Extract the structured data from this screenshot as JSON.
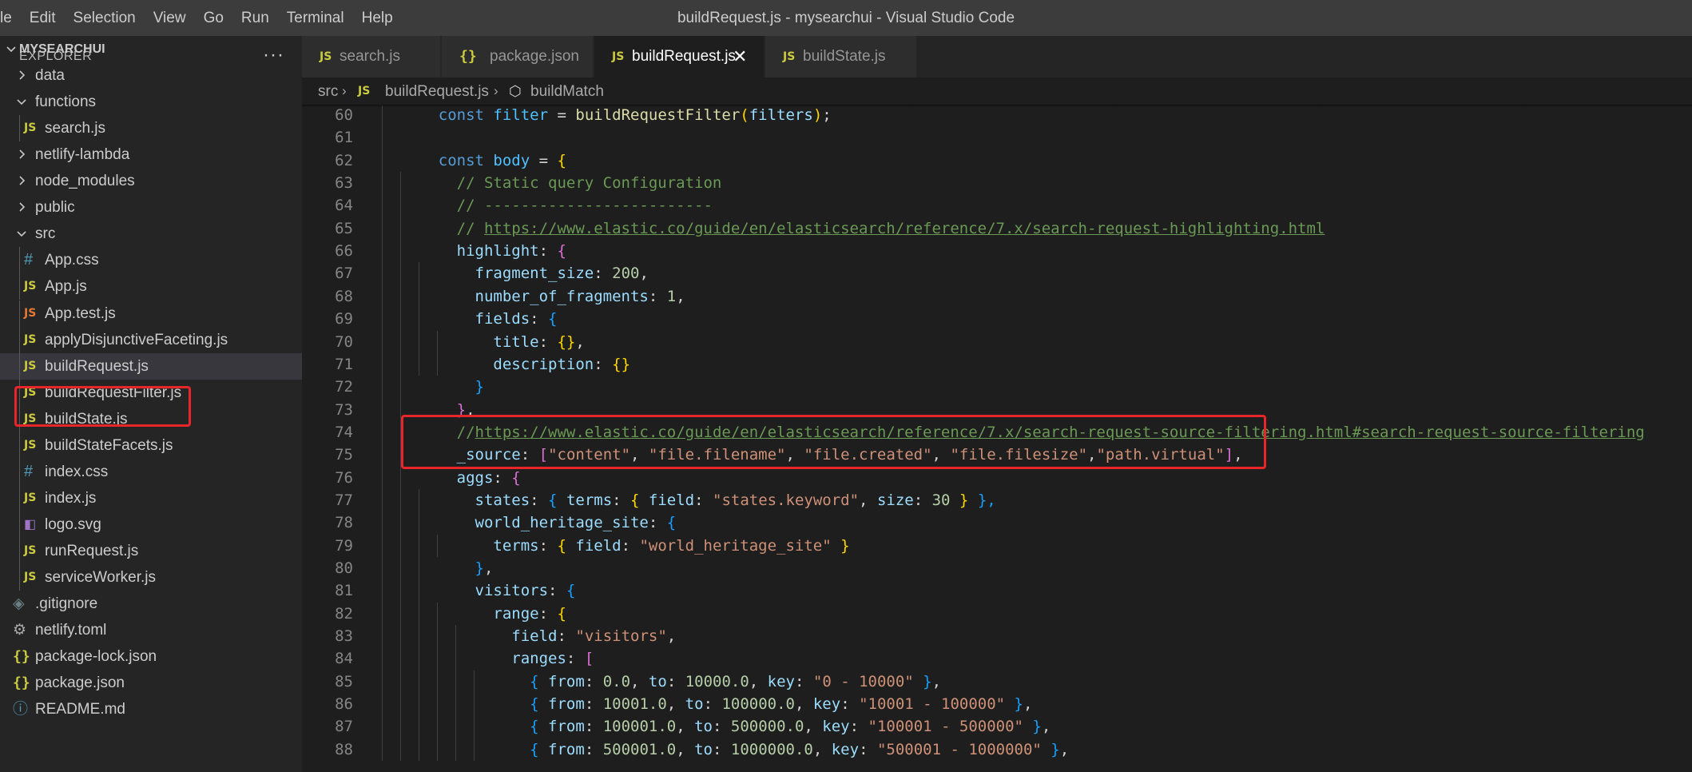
{
  "menu": {
    "items": [
      "le",
      "Edit",
      "Selection",
      "View",
      "Go",
      "Run",
      "Terminal",
      "Help"
    ]
  },
  "window_title": "buildRequest.js - mysearchui - Visual Studio Code",
  "sidebar": {
    "title": "EXPLORER",
    "more_icon": "···",
    "project": "MYSEARCHUI",
    "items": [
      {
        "label": "data",
        "type": "folder",
        "expanded": false,
        "depth": 0
      },
      {
        "label": "functions",
        "type": "folder",
        "expanded": true,
        "depth": 0
      },
      {
        "label": "search.js",
        "type": "js",
        "depth": 1
      },
      {
        "label": "netlify-lambda",
        "type": "folder",
        "expanded": false,
        "depth": 0
      },
      {
        "label": "node_modules",
        "type": "folder",
        "expanded": false,
        "depth": 0
      },
      {
        "label": "public",
        "type": "folder",
        "expanded": false,
        "depth": 0
      },
      {
        "label": "src",
        "type": "folder",
        "expanded": true,
        "depth": 0
      },
      {
        "label": "App.css",
        "type": "css",
        "depth": 1
      },
      {
        "label": "App.js",
        "type": "js",
        "depth": 1
      },
      {
        "label": "App.test.js",
        "type": "jstest",
        "depth": 1
      },
      {
        "label": "applyDisjunctiveFaceting.js",
        "type": "js",
        "depth": 1
      },
      {
        "label": "buildRequest.js",
        "type": "js",
        "depth": 1,
        "selected": true
      },
      {
        "label": "buildRequestFilter.js",
        "type": "js",
        "depth": 1
      },
      {
        "label": "buildState.js",
        "type": "js",
        "depth": 1
      },
      {
        "label": "buildStateFacets.js",
        "type": "js",
        "depth": 1
      },
      {
        "label": "index.css",
        "type": "css",
        "depth": 1
      },
      {
        "label": "index.js",
        "type": "js",
        "depth": 1
      },
      {
        "label": "logo.svg",
        "type": "svg",
        "depth": 1
      },
      {
        "label": "runRequest.js",
        "type": "js",
        "depth": 1
      },
      {
        "label": "serviceWorker.js",
        "type": "js",
        "depth": 1
      },
      {
        "label": ".gitignore",
        "type": "git",
        "depth": 0
      },
      {
        "label": "netlify.toml",
        "type": "toml",
        "depth": 0
      },
      {
        "label": "package-lock.json",
        "type": "json",
        "depth": 0
      },
      {
        "label": "package.json",
        "type": "json",
        "depth": 0
      },
      {
        "label": "README.md",
        "type": "md",
        "depth": 0
      }
    ]
  },
  "icons": {
    "js": "JS",
    "css": "#",
    "json": "{}",
    "md": "ⓘ",
    "toml": "⚙",
    "git": "◈",
    "svg": "◧",
    "close": "✕"
  },
  "tabs": [
    {
      "label": "search.js",
      "icon": "JS",
      "active": false
    },
    {
      "label": "package.json",
      "icon": "{}",
      "active": false
    },
    {
      "label": "buildRequest.js",
      "icon": "JS",
      "active": true
    },
    {
      "label": "buildState.js",
      "icon": "JS",
      "active": false
    }
  ],
  "breadcrumb": {
    "folder": "src",
    "file": "buildRequest.js",
    "symbol": "buildMatch",
    "file_icon": "JS",
    "symbol_icon": "⬡"
  },
  "code": [
    {
      "n": "60",
      "t": [
        [
          "    ",
          "pun"
        ],
        [
          "const ",
          "kw"
        ],
        [
          "filter",
          "var"
        ],
        [
          " = ",
          "pun"
        ],
        [
          "buildRequestFilter",
          "fn"
        ],
        [
          "(",
          "p1"
        ],
        [
          "filters",
          "prop"
        ],
        [
          ")",
          "p1"
        ],
        [
          ";",
          "pun"
        ]
      ]
    },
    {
      "n": "61",
      "t": []
    },
    {
      "n": "62",
      "t": [
        [
          "    ",
          "pun"
        ],
        [
          "const ",
          "kw"
        ],
        [
          "body",
          "var"
        ],
        [
          " = ",
          "pun"
        ],
        [
          "{",
          "p1"
        ]
      ]
    },
    {
      "n": "63",
      "t": [
        [
          "      ",
          "pun"
        ],
        [
          "// Static query Configuration",
          "com"
        ]
      ]
    },
    {
      "n": "64",
      "t": [
        [
          "      ",
          "pun"
        ],
        [
          "// -------------------------",
          "com"
        ]
      ]
    },
    {
      "n": "65",
      "t": [
        [
          "      ",
          "pun"
        ],
        [
          "// ",
          "com"
        ],
        [
          "https://www.elastic.co/guide/en/elasticsearch/reference/7.x/search-request-highlighting.html",
          "link"
        ]
      ]
    },
    {
      "n": "66",
      "t": [
        [
          "      ",
          "pun"
        ],
        [
          "highlight",
          "prop"
        ],
        [
          ": ",
          "pun"
        ],
        [
          "{",
          "p2"
        ]
      ]
    },
    {
      "n": "67",
      "t": [
        [
          "        ",
          "pun"
        ],
        [
          "fragment_size",
          "prop"
        ],
        [
          ": ",
          "pun"
        ],
        [
          "200",
          "num"
        ],
        [
          ",",
          "pun"
        ]
      ]
    },
    {
      "n": "68",
      "t": [
        [
          "        ",
          "pun"
        ],
        [
          "number_of_fragments",
          "prop"
        ],
        [
          ": ",
          "pun"
        ],
        [
          "1",
          "num"
        ],
        [
          ",",
          "pun"
        ]
      ]
    },
    {
      "n": "69",
      "t": [
        [
          "        ",
          "pun"
        ],
        [
          "fields",
          "prop"
        ],
        [
          ": ",
          "pun"
        ],
        [
          "{",
          "p3"
        ]
      ]
    },
    {
      "n": "70",
      "t": [
        [
          "          ",
          "pun"
        ],
        [
          "title",
          "prop"
        ],
        [
          ": ",
          "pun"
        ],
        [
          "{}",
          "p1"
        ],
        [
          ",",
          "pun"
        ]
      ]
    },
    {
      "n": "71",
      "t": [
        [
          "          ",
          "pun"
        ],
        [
          "description",
          "prop"
        ],
        [
          ": ",
          "pun"
        ],
        [
          "{}",
          "p1"
        ]
      ]
    },
    {
      "n": "72",
      "t": [
        [
          "        ",
          "pun"
        ],
        [
          "}",
          "p3"
        ]
      ]
    },
    {
      "n": "73",
      "t": [
        [
          "      ",
          "pun"
        ],
        [
          "}",
          "p2"
        ],
        [
          ",",
          "pun"
        ]
      ]
    },
    {
      "n": "74",
      "t": [
        [
          "      ",
          "pun"
        ],
        [
          "//",
          "com"
        ],
        [
          "https://www.elastic.co/guide/en/elasticsearch/reference/7.x/search-request-source-filtering.html#search-request-source-filtering",
          "link"
        ]
      ]
    },
    {
      "n": "75",
      "t": [
        [
          "      ",
          "pun"
        ],
        [
          "_source",
          "prop"
        ],
        [
          ": ",
          "pun"
        ],
        [
          "[",
          "p2"
        ],
        [
          "\"content\"",
          "str"
        ],
        [
          ", ",
          "pun"
        ],
        [
          "\"file.filename\"",
          "str"
        ],
        [
          ", ",
          "pun"
        ],
        [
          "\"file.created\"",
          "str"
        ],
        [
          ", ",
          "pun"
        ],
        [
          "\"file.filesize\"",
          "str"
        ],
        [
          ",",
          "pun"
        ],
        [
          "\"path.virtual\"",
          "str"
        ],
        [
          "]",
          "p2"
        ],
        [
          ",",
          "pun"
        ]
      ]
    },
    {
      "n": "76",
      "t": [
        [
          "      ",
          "pun"
        ],
        [
          "aggs",
          "prop"
        ],
        [
          ": ",
          "pun"
        ],
        [
          "{",
          "p2"
        ]
      ]
    },
    {
      "n": "77",
      "t": [
        [
          "        ",
          "pun"
        ],
        [
          "states",
          "prop"
        ],
        [
          ": ",
          "pun"
        ],
        [
          "{ ",
          "p3"
        ],
        [
          "terms",
          "prop"
        ],
        [
          ": ",
          "pun"
        ],
        [
          "{ ",
          "p1"
        ],
        [
          "field",
          "prop"
        ],
        [
          ": ",
          "pun"
        ],
        [
          "\"states.keyword\"",
          "str"
        ],
        [
          ", ",
          "pun"
        ],
        [
          "size",
          "prop"
        ],
        [
          ": ",
          "pun"
        ],
        [
          "30",
          "num"
        ],
        [
          " }",
          "p1"
        ],
        [
          " },",
          "p3"
        ]
      ]
    },
    {
      "n": "78",
      "t": [
        [
          "        ",
          "pun"
        ],
        [
          "world_heritage_site",
          "prop"
        ],
        [
          ": ",
          "pun"
        ],
        [
          "{",
          "p3"
        ]
      ]
    },
    {
      "n": "79",
      "t": [
        [
          "          ",
          "pun"
        ],
        [
          "terms",
          "prop"
        ],
        [
          ": ",
          "pun"
        ],
        [
          "{ ",
          "p1"
        ],
        [
          "field",
          "prop"
        ],
        [
          ": ",
          "pun"
        ],
        [
          "\"world_heritage_site\"",
          "str"
        ],
        [
          " }",
          "p1"
        ]
      ]
    },
    {
      "n": "80",
      "t": [
        [
          "        ",
          "pun"
        ],
        [
          "}",
          "p3"
        ],
        [
          ",",
          "pun"
        ]
      ]
    },
    {
      "n": "81",
      "t": [
        [
          "        ",
          "pun"
        ],
        [
          "visitors",
          "prop"
        ],
        [
          ": ",
          "pun"
        ],
        [
          "{",
          "p3"
        ]
      ]
    },
    {
      "n": "82",
      "t": [
        [
          "          ",
          "pun"
        ],
        [
          "range",
          "prop"
        ],
        [
          ": ",
          "pun"
        ],
        [
          "{",
          "p1"
        ]
      ]
    },
    {
      "n": "83",
      "t": [
        [
          "            ",
          "pun"
        ],
        [
          "field",
          "prop"
        ],
        [
          ": ",
          "pun"
        ],
        [
          "\"visitors\"",
          "str"
        ],
        [
          ",",
          "pun"
        ]
      ]
    },
    {
      "n": "84",
      "t": [
        [
          "            ",
          "pun"
        ],
        [
          "ranges",
          "prop"
        ],
        [
          ": ",
          "pun"
        ],
        [
          "[",
          "p2"
        ]
      ]
    },
    {
      "n": "85",
      "t": [
        [
          "              ",
          "pun"
        ],
        [
          "{ ",
          "p3"
        ],
        [
          "from",
          "prop"
        ],
        [
          ": ",
          "pun"
        ],
        [
          "0.0",
          "num"
        ],
        [
          ", ",
          "pun"
        ],
        [
          "to",
          "prop"
        ],
        [
          ": ",
          "pun"
        ],
        [
          "10000.0",
          "num"
        ],
        [
          ", ",
          "pun"
        ],
        [
          "key",
          "prop"
        ],
        [
          ": ",
          "pun"
        ],
        [
          "\"0 - 10000\"",
          "str"
        ],
        [
          " }",
          "p3"
        ],
        [
          ",",
          "pun"
        ]
      ]
    },
    {
      "n": "86",
      "t": [
        [
          "              ",
          "pun"
        ],
        [
          "{ ",
          "p3"
        ],
        [
          "from",
          "prop"
        ],
        [
          ": ",
          "pun"
        ],
        [
          "10001.0",
          "num"
        ],
        [
          ", ",
          "pun"
        ],
        [
          "to",
          "prop"
        ],
        [
          ": ",
          "pun"
        ],
        [
          "100000.0",
          "num"
        ],
        [
          ", ",
          "pun"
        ],
        [
          "key",
          "prop"
        ],
        [
          ": ",
          "pun"
        ],
        [
          "\"10001 - 100000\"",
          "str"
        ],
        [
          " }",
          "p3"
        ],
        [
          ",",
          "pun"
        ]
      ]
    },
    {
      "n": "87",
      "t": [
        [
          "              ",
          "pun"
        ],
        [
          "{ ",
          "p3"
        ],
        [
          "from",
          "prop"
        ],
        [
          ": ",
          "pun"
        ],
        [
          "100001.0",
          "num"
        ],
        [
          ", ",
          "pun"
        ],
        [
          "to",
          "prop"
        ],
        [
          ": ",
          "pun"
        ],
        [
          "500000.0",
          "num"
        ],
        [
          ", ",
          "pun"
        ],
        [
          "key",
          "prop"
        ],
        [
          ": ",
          "pun"
        ],
        [
          "\"100001 - 500000\"",
          "str"
        ],
        [
          " }",
          "p3"
        ],
        [
          ",",
          "pun"
        ]
      ]
    },
    {
      "n": "88",
      "t": [
        [
          "              ",
          "pun"
        ],
        [
          "{ ",
          "p3"
        ],
        [
          "from",
          "prop"
        ],
        [
          ": ",
          "pun"
        ],
        [
          "500001.0",
          "num"
        ],
        [
          ", ",
          "pun"
        ],
        [
          "to",
          "prop"
        ],
        [
          ": ",
          "pun"
        ],
        [
          "1000000.0",
          "num"
        ],
        [
          ", ",
          "pun"
        ],
        [
          "key",
          "prop"
        ],
        [
          ": ",
          "pun"
        ],
        [
          "\"500001 - 1000000\"",
          "str"
        ],
        [
          " }",
          "p3"
        ],
        [
          ",",
          "pun"
        ]
      ]
    }
  ]
}
